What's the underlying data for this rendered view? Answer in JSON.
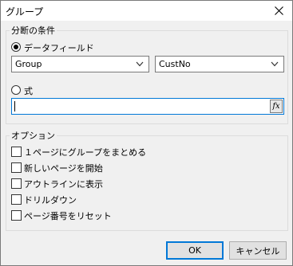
{
  "window": {
    "title": "グループ"
  },
  "condition_group": {
    "label": "分断の条件",
    "data_field_option": {
      "label": "データフィールド",
      "selected": true
    },
    "field1": {
      "value": "Group"
    },
    "field2": {
      "value": "CustNo"
    },
    "expression_option": {
      "label": "式",
      "selected": false
    },
    "expression_input": {
      "value": "",
      "fx_label": "fx"
    }
  },
  "options_group": {
    "label": "オプション",
    "items": [
      {
        "label": "１ページにグループをまとめる",
        "checked": false
      },
      {
        "label": "新しいページを開始",
        "checked": false
      },
      {
        "label": "アウトラインに表示",
        "checked": false
      },
      {
        "label": "ドリルダウン",
        "checked": false
      },
      {
        "label": "ページ番号をリセット",
        "checked": false
      }
    ]
  },
  "buttons": {
    "ok": "OK",
    "cancel": "キャンセル"
  }
}
